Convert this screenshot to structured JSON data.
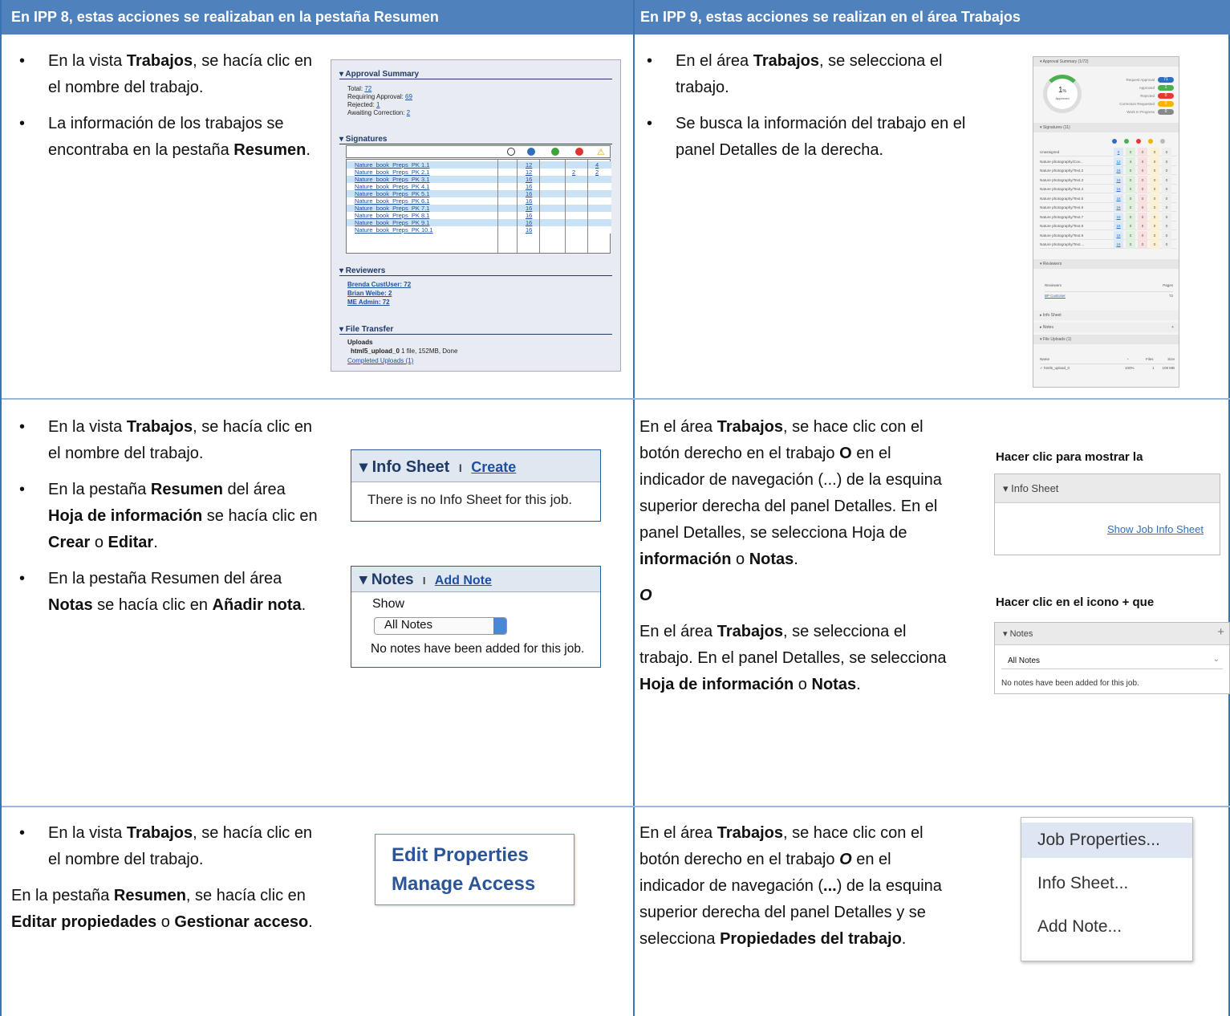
{
  "header": {
    "left": "En IPP 8, estas acciones se realizaban en la pestaña Resumen",
    "right": "En IPP 9, estas acciones se realizan en el área Trabajos"
  },
  "row1": {
    "left_bullets": [
      [
        "En la vista ",
        "Trabajos",
        ", se hacía clic en el nombre del trabajo."
      ],
      [
        "La información de los trabajos se encontraba en la pestaña ",
        "Resumen",
        "."
      ]
    ],
    "right_bullets": [
      [
        "En el área ",
        "Trabajos",
        ", se selecciona el trabajo."
      ],
      [
        "Se busca la información del trabajo en el panel Detalles de la derecha.",
        "",
        ""
      ]
    ],
    "old_panel": {
      "approval_title": "▾ Approval Summary",
      "total_label": "Total: ",
      "total": "72",
      "requiring_label": "Requiring Approval: ",
      "requiring": "69",
      "rejected_label": "Rejected: ",
      "rejected": "1",
      "awaiting_label": "Awaiting Correction: ",
      "awaiting": "2",
      "signatures_title": "▾ Signatures",
      "sig_rows": [
        {
          "name": "Nature_book_Preps_PK 1.1",
          "count": "12",
          "red": "",
          "warn": "4"
        },
        {
          "name": "Nature_book_Preps_PK 2.1",
          "count": "12",
          "red": "2",
          "warn": "2"
        },
        {
          "name": "Nature_book_Preps_PK 3.1",
          "count": "16",
          "red": "",
          "warn": ""
        },
        {
          "name": "Nature_book_Preps_PK 4.1",
          "count": "16",
          "red": "",
          "warn": ""
        },
        {
          "name": "Nature_book_Preps_PK 5.1",
          "count": "16",
          "red": "",
          "warn": ""
        },
        {
          "name": "Nature_book_Preps_PK 6.1",
          "count": "16",
          "red": "",
          "warn": ""
        },
        {
          "name": "Nature_book_Preps_PK 7.1",
          "count": "16",
          "red": "",
          "warn": ""
        },
        {
          "name": "Nature_book_Preps_PK 8.1",
          "count": "16",
          "red": "",
          "warn": ""
        },
        {
          "name": "Nature_book_Preps_PK 9.1",
          "count": "16",
          "red": "",
          "warn": ""
        },
        {
          "name": "Nature_book_Preps_PK 10.1",
          "count": "16",
          "red": "",
          "warn": ""
        }
      ],
      "reviewers_title": "▾ Reviewers",
      "reviewers": [
        "Brenda CustUser: 72",
        "Brian Weibe: 2",
        "ME Admin: 72"
      ],
      "file_transfer_title": "▾ File Transfer",
      "uploads_label": "Uploads",
      "upload_name": "html5_upload_0",
      "upload_info": " 1 file, 152MB, Done",
      "completed_uploads": "Completed Uploads (1)"
    },
    "new_panel": {
      "approval_title": "▾  Approval Summary (1/72)",
      "donut_value": "1",
      "donut_unit": "%",
      "donut_label": "Approved",
      "status": [
        {
          "label": "Request Approval",
          "count": "71",
          "color": "#2f6fbf"
        },
        {
          "label": "Approved",
          "count": "1",
          "color": "#4caf50"
        },
        {
          "label": "Rejected",
          "count": "0",
          "color": "#e53935"
        },
        {
          "label": "Correction Requested",
          "count": "0",
          "color": "#f5b400"
        },
        {
          "label": "Work In Progress",
          "count": "0",
          "color": "#888888"
        }
      ],
      "signatures_title": "▾  Signatures (11)",
      "sig_rows": [
        {
          "name": "Unassigned",
          "a": "0",
          "b": "0",
          "c": "0",
          "d": "0",
          "e": "0"
        },
        {
          "name": "Nature photography/Cov...",
          "a": "12",
          "b": "4",
          "c": "0",
          "d": "0",
          "e": "0"
        },
        {
          "name": "Nature photography/Text.2",
          "a": "16",
          "b": "0",
          "c": "0",
          "d": "0",
          "e": "0"
        },
        {
          "name": "Nature photography/Text.3",
          "a": "16",
          "b": "0",
          "c": "0",
          "d": "0",
          "e": "0"
        },
        {
          "name": "Nature photography/Text.4",
          "a": "16",
          "b": "0",
          "c": "0",
          "d": "0",
          "e": "0"
        },
        {
          "name": "Nature photography/Text.5",
          "a": "16",
          "b": "0",
          "c": "0",
          "d": "0",
          "e": "0"
        },
        {
          "name": "Nature photography/Text.6",
          "a": "16",
          "b": "0",
          "c": "0",
          "d": "0",
          "e": "0"
        },
        {
          "name": "Nature photography/Text.7",
          "a": "16",
          "b": "0",
          "c": "0",
          "d": "0",
          "e": "0"
        },
        {
          "name": "Nature photography/Text.8",
          "a": "16",
          "b": "0",
          "c": "0",
          "d": "0",
          "e": "0"
        },
        {
          "name": "Nature photography/Text.9",
          "a": "16",
          "b": "0",
          "c": "0",
          "d": "0",
          "e": "0"
        },
        {
          "name": "Nature photography/Text....",
          "a": "16",
          "b": "0",
          "c": "0",
          "d": "0",
          "e": "0"
        }
      ],
      "reviewers_title": "▾  Reviewers",
      "reviewers_col": "Reviewers",
      "pages_col": "Pages",
      "reviewer": "BP CustUser",
      "reviewer_pages": "72",
      "info_sheet": "▸  Info Sheet",
      "notes": "▸  Notes",
      "notes_plus": "+",
      "file_uploads": "▾  File Uploads (1)",
      "name_col": "Name",
      "files_col": "Files",
      "size_col": "Size",
      "upload_name": "✓ html5_upload_0",
      "upload_pct": "100%",
      "upload_files": "1",
      "upload_size": "109 MB"
    }
  },
  "row2": {
    "left_bullets": [
      [
        "En la vista ",
        "Trabajos",
        ", se hacía clic en el nombre del trabajo.",
        "",
        ""
      ],
      [
        "En la pestaña ",
        "Resumen",
        " del área ",
        "Hoja de información",
        " se hacía clic en "
      ],
      [
        "En la pestaña Resumen del área ",
        "Notas",
        " se hacía clic en ",
        "Añadir nota",
        "."
      ]
    ],
    "bullet2_tail": [
      "Crear",
      " o ",
      "Editar",
      "."
    ],
    "info_old": {
      "title": "▾ Info Sheet",
      "sep": "I",
      "create": "Create",
      "body": "There is no Info Sheet for this job."
    },
    "notes_old": {
      "title": "▾ Notes",
      "sep": "I",
      "add": "Add Note",
      "show": "Show",
      "select": "All Notes",
      "body": "No notes have been added for this job."
    },
    "right": {
      "p1": [
        "En el área ",
        "Trabajos",
        ", se hace clic con el botón derecho en el trabajo ",
        "O",
        " en el indicador de navegación (...) de la esquina superior derecha del panel Detalles. En el panel Detalles, se selecciona Hoja de ",
        "información",
        " o ",
        "Notas",
        "."
      ],
      "or": "O",
      "p2": [
        "En el área ",
        "Trabajos",
        ", se selecciona el trabajo. En el panel Detalles, se selecciona ",
        "Hoja de información",
        " o ",
        "Notas",
        "."
      ]
    },
    "hint_info": "Hacer clic para mostrar la",
    "info_new": {
      "title": "▾  Info Sheet",
      "link": "Show Job Info Sheet"
    },
    "hint_notes": "Hacer clic en el icono + que",
    "notes_new": {
      "title": "▾  Notes",
      "plus": "+",
      "select": "All Notes",
      "chev": "⌄",
      "body": "No notes have been added for this job."
    }
  },
  "row3": {
    "left_bullet": [
      "En la vista ",
      "Trabajos",
      ", se hacía clic en el nombre del trabajo."
    ],
    "left_para": [
      "En la pestaña ",
      "Resumen",
      ", se hacía clic en ",
      "Editar propiedades",
      " o ",
      "Gestionar acceso",
      "."
    ],
    "old_links": [
      "Edit Properties",
      "Manage Access"
    ],
    "right": [
      "En el área ",
      "Trabajos",
      ", se hace clic con el botón derecho en el trabajo ",
      "O",
      " en el indicador de navegación (",
      "...",
      ") de la esquina superior derecha del panel Detalles y se selecciona ",
      "Propiedades del trabajo",
      "."
    ],
    "menu": [
      "Job Properties...",
      "Info Sheet...",
      "Add Note..."
    ]
  },
  "colors": {
    "header": "#4f81bd",
    "border": "#3a73b4",
    "link": "#1e4fa0"
  }
}
